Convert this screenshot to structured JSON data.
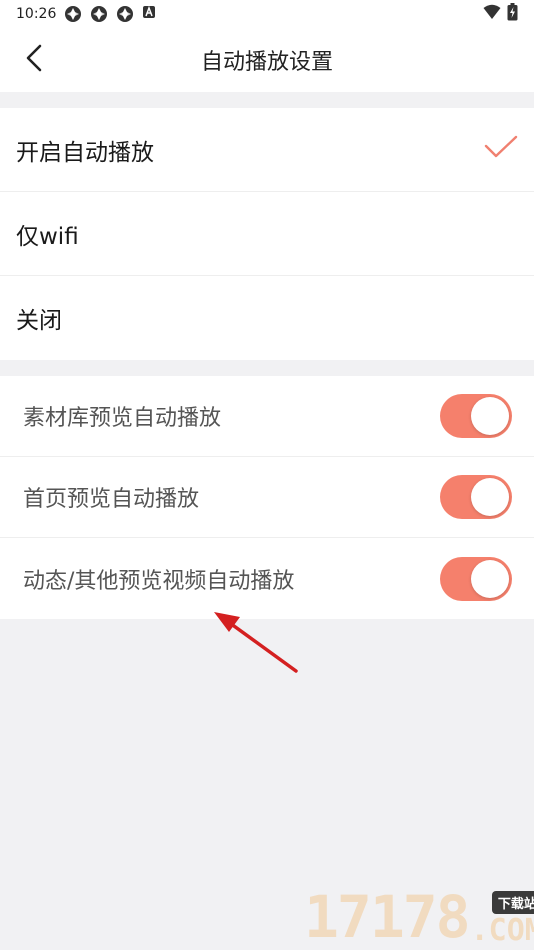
{
  "status_bar": {
    "time": "10:26",
    "left_icons": [
      "app-notification-icon",
      "app-notification-icon",
      "app-notification-icon",
      "a-badge-icon"
    ],
    "right_icons": [
      "wifi-icon",
      "battery-charging-icon"
    ]
  },
  "header": {
    "title": "自动播放设置",
    "back_icon": "chevron-left-icon"
  },
  "autoplay_options": [
    {
      "label": "开启自动播放",
      "selected": true
    },
    {
      "label": "仅wifi",
      "selected": false
    },
    {
      "label": "关闭",
      "selected": false
    }
  ],
  "preview_toggles": [
    {
      "label": "素材库预览自动播放",
      "on": true
    },
    {
      "label": "首页预览自动播放",
      "on": true
    },
    {
      "label": "动态/其他预览视频自动播放",
      "on": true
    }
  ],
  "watermark": {
    "number": "17178",
    "badge": "下载站",
    "domain": ".COM"
  },
  "colors": {
    "accent": "#f5806c",
    "check": "#f08070",
    "annotation_arrow": "#d42020",
    "background": "#f1f1f3"
  }
}
